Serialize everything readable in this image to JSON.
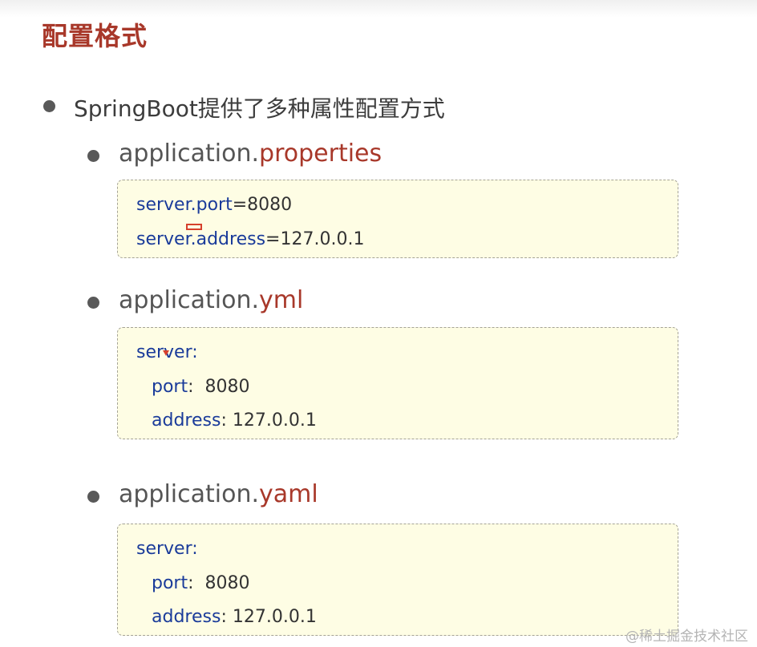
{
  "title": "配置格式",
  "intro": "SpringBoot提供了多种属性配置方式",
  "sections": [
    {
      "file_base": "application.",
      "file_ext": "properties",
      "lines": [
        {
          "key": "server.port",
          "sep": "=",
          "value": "8080"
        },
        {
          "key": "server.address",
          "sep": "=",
          "value": "127.0.0.1"
        }
      ]
    },
    {
      "file_base": "application.",
      "file_ext": "yml",
      "lines": [
        {
          "key": "server:",
          "sep": "",
          "value": ""
        },
        {
          "key": "port",
          "sep": ":",
          "value": "  8080"
        },
        {
          "key": "address",
          "sep": ":",
          "value": " 127.0.0.1"
        }
      ]
    },
    {
      "file_base": "application.",
      "file_ext": "yaml",
      "lines": [
        {
          "key": "server:",
          "sep": "",
          "value": ""
        },
        {
          "key": "port",
          "sep": ":",
          "value": "  8080"
        },
        {
          "key": "address",
          "sep": ":",
          "value": " 127.0.0.1"
        }
      ]
    }
  ],
  "watermark": "@稀土掘金技术社区",
  "colors": {
    "accent": "#a8382a",
    "key": "#1a3b9a",
    "code_bg": "#fefde4",
    "mark": "#d6402c"
  }
}
